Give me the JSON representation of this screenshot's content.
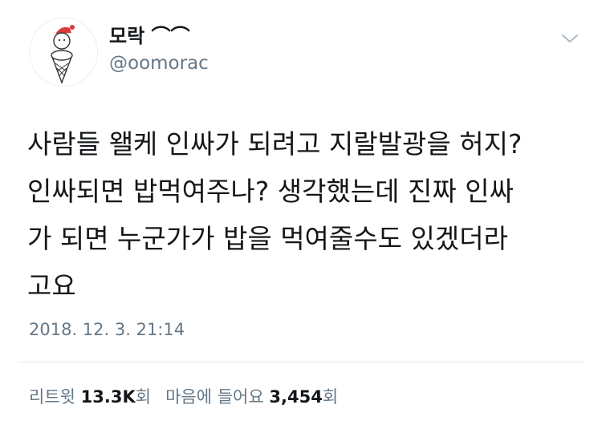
{
  "author": {
    "display_name": "모락 ⌒⌒",
    "handle": "@oomorac"
  },
  "tweet": {
    "text": "사람들 왤케 인싸가 되려고 지랄발광을 허지?\n인싸되면 밥먹여주나? 생각했는데 진짜 인싸\n가 되면 누군가가 밥을 먹여줄수도 있겠더라\n고요",
    "timestamp": "2018. 12. 3. 21:14"
  },
  "stats": {
    "retweets_label": "리트윗",
    "retweets_count": "13.3K",
    "retweets_unit": "회",
    "likes_label": "마음에 들어요",
    "likes_count": "3,454",
    "likes_unit": "회"
  },
  "icons": {
    "menu": "chevron-down-icon",
    "avatar": "ice-cream-avatar"
  },
  "colors": {
    "text": "#14171a",
    "secondary": "#657786",
    "divider": "#e1e8ed"
  }
}
